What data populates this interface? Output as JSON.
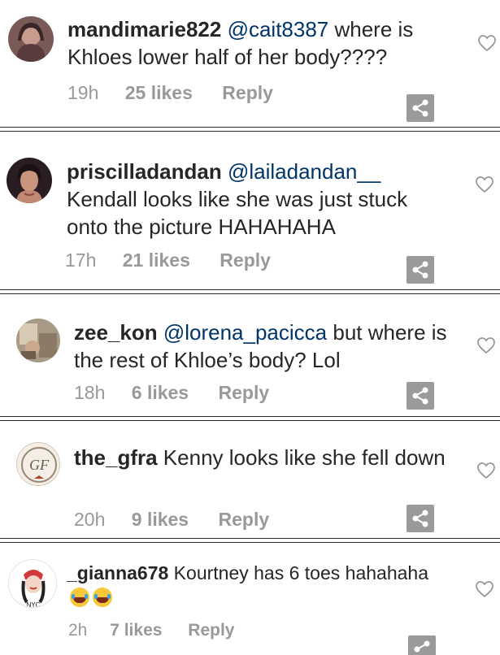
{
  "comments": [
    {
      "username": "mandimarie822",
      "mention": "@cait8387",
      "text": " where is Khloes lower half of her body????",
      "time": "19h",
      "likes": "25 likes",
      "reply": "Reply",
      "avatar": "avatar-dark-hair"
    },
    {
      "username": "priscilladandan",
      "mention": "@lailadandan__",
      "text": " Kendall looks like she was just stuck onto the picture HAHAHAHA",
      "time": "17h",
      "likes": "21 likes",
      "reply": "Reply",
      "avatar": "avatar-woman"
    },
    {
      "username": "zee_kon",
      "mention": "@lorena_pacicca",
      "text": " but where is the rest of Khloe’s body? Lol",
      "time": "18h",
      "likes": "6 likes",
      "reply": "Reply",
      "avatar": "avatar-photo"
    },
    {
      "username": "the_gfra",
      "mention": "",
      "text": " Kenny looks like she fell down",
      "time": "20h",
      "likes": "9 likes",
      "reply": "Reply",
      "avatar": "avatar-monogram"
    },
    {
      "username": "_gianna678",
      "mention": "",
      "text": " Kourtney has 6 toes hahahaha",
      "emoji": "😂😂",
      "time": "2h",
      "likes": "7 likes",
      "reply": "Reply",
      "avatar": "avatar-cartoon"
    }
  ],
  "icons": {
    "like": "heart-outline-icon",
    "share": "share-icon"
  },
  "colors": {
    "text": "#262626",
    "meta": "#999999",
    "share_bg": "#9a9a9a",
    "divider": "#2c2c2c"
  }
}
